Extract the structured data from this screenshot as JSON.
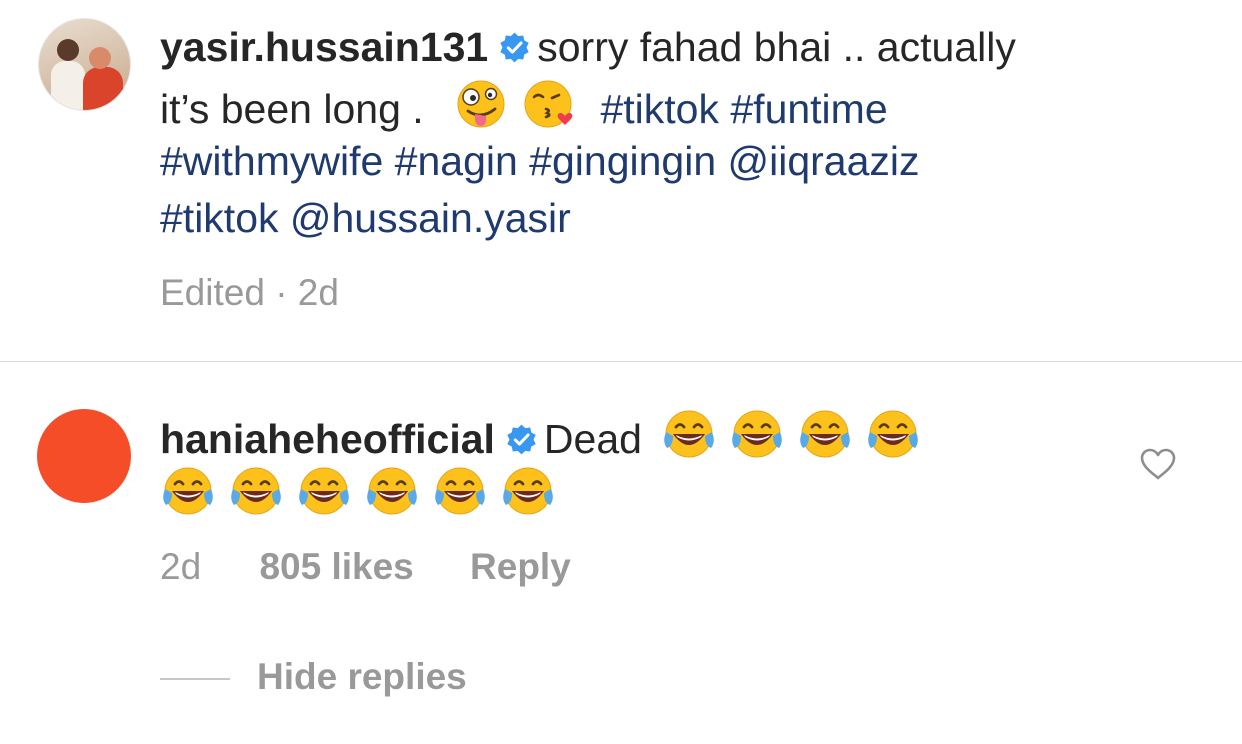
{
  "comment1": {
    "username": "yasir.hussain131",
    "line1_text": "sorry fahad bhai .. actually",
    "line2_text": "it’s been long .",
    "line2_tags": "#tiktok #funtime",
    "line3": "#withmywife #nagin #gingingin @iiqraaziz",
    "line4": "#tiktok @hussain.yasir",
    "meta": "Edited · 2d",
    "emojis": [
      "zany-face-emoji",
      "kissing-face-emoji"
    ]
  },
  "comment2": {
    "username": "haniaheheofficial",
    "text": "Dead",
    "time": "2d",
    "likes": "805 likes",
    "reply_label": "Reply",
    "emoji": "tears-of-joy-emoji",
    "emoji_count": 10,
    "avatar_color": "#f44d27"
  },
  "replies": {
    "toggle_label": "Hide replies"
  },
  "colors": {
    "text": "#262626",
    "hashtag": "#1f3a6e",
    "meta": "#999999",
    "verified": "#3897f0"
  },
  "icons": {
    "verified": "verified-badge-icon",
    "like": "heart-outline-icon"
  }
}
